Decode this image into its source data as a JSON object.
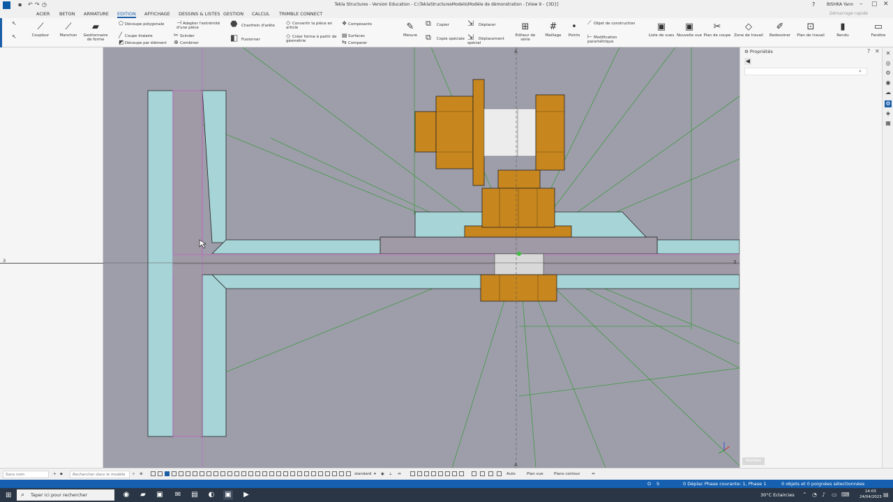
{
  "window": {
    "title": "Tekla Structures - Version Education - C:\\TeklaStructuresModels\\Modèle de démonstration - [View 9 - {3D}]",
    "user": "BISHKA Yann",
    "quick_launch_placeholder": "Démarrage rapide"
  },
  "menu": {
    "items": [
      "ACIER",
      "BETON",
      "ARMATURE",
      "EDITION",
      "AFFICHAGE",
      "DESSINS & LISTES",
      "GESTION",
      "CALCUL",
      "TRIMBLE CONNECT"
    ],
    "active": "EDITION"
  },
  "ribbon": {
    "coupleur": "Coupleur",
    "manchon": "Manchon",
    "gestionnaire": "Gestionnaire de forme",
    "decoupe_poly": "Découpe polygonale",
    "coupe_lineaire": "Coupe linéaire",
    "decoupe_element": "Découpe par élément",
    "adapter": "Adapter l'extrémité d'une pièce",
    "scinder": "Scinder",
    "combiner": "Combiner",
    "chanfrein": "Chanfrein d'arête",
    "fusionner": "Fusionner",
    "convertir": "Convertir la pièce en article",
    "creer_forme": "Créer forme à partir de géométrie",
    "composants": "Composants",
    "surfaces": "Surfaces",
    "comparer": "Comparer",
    "mesure": "Mesure",
    "copier": "Copier",
    "copie_speciale": "Copie spéciale",
    "deplacer": "Déplacer",
    "deplacement_special": "Déplacement spécial",
    "editeur_serie": "Editeur de série",
    "maillage": "Maillage",
    "points": "Points",
    "objet_construction": "Objet de construction",
    "modif_param": "Modification paramétrique",
    "liste_vues": "Liste de vues",
    "nouvelle_vue": "Nouvelle vue",
    "plan_coupe": "Plan de coupe",
    "zone_travail": "Zone de travail",
    "redessiner": "Redessiner",
    "plan_travail": "Plan de travail",
    "rendu": "Rendu",
    "fenetre": "Fenêtre"
  },
  "viewport": {
    "grid_label_left": "3",
    "grid_label_right": "3",
    "grid_label_top": "A",
    "grid_label_bottom": "A"
  },
  "properties_panel": {
    "title": "Propriétés",
    "apply_label": "Modifier"
  },
  "bottom_toolbar": {
    "filter_placeholder": "Sans nom",
    "search_placeholder": "Rechercher dans le modèle",
    "standard": "standard",
    "auto": "Auto",
    "plan_vue": "Plan vue",
    "plans_contour": "Plans contour"
  },
  "status_bar": {
    "o": "O",
    "s": "S",
    "mode": "0 Déplac Phase courante: 1, Phase 1",
    "selection": "0 objets et 0 poignées sélectionnées"
  },
  "taskbar": {
    "search_placeholder": "Taper ici pour rechercher",
    "weather": "30°C Eclaircies",
    "time": "14:03",
    "date": "24/04/2023"
  },
  "colors": {
    "accent": "#1a5ea8",
    "viewport_bg": "#9e9eab",
    "steel_plate": "#a7d4d6",
    "bolt": "#c8861e",
    "grid_line": "#3f9a3f",
    "highlight": "#c060c0"
  }
}
